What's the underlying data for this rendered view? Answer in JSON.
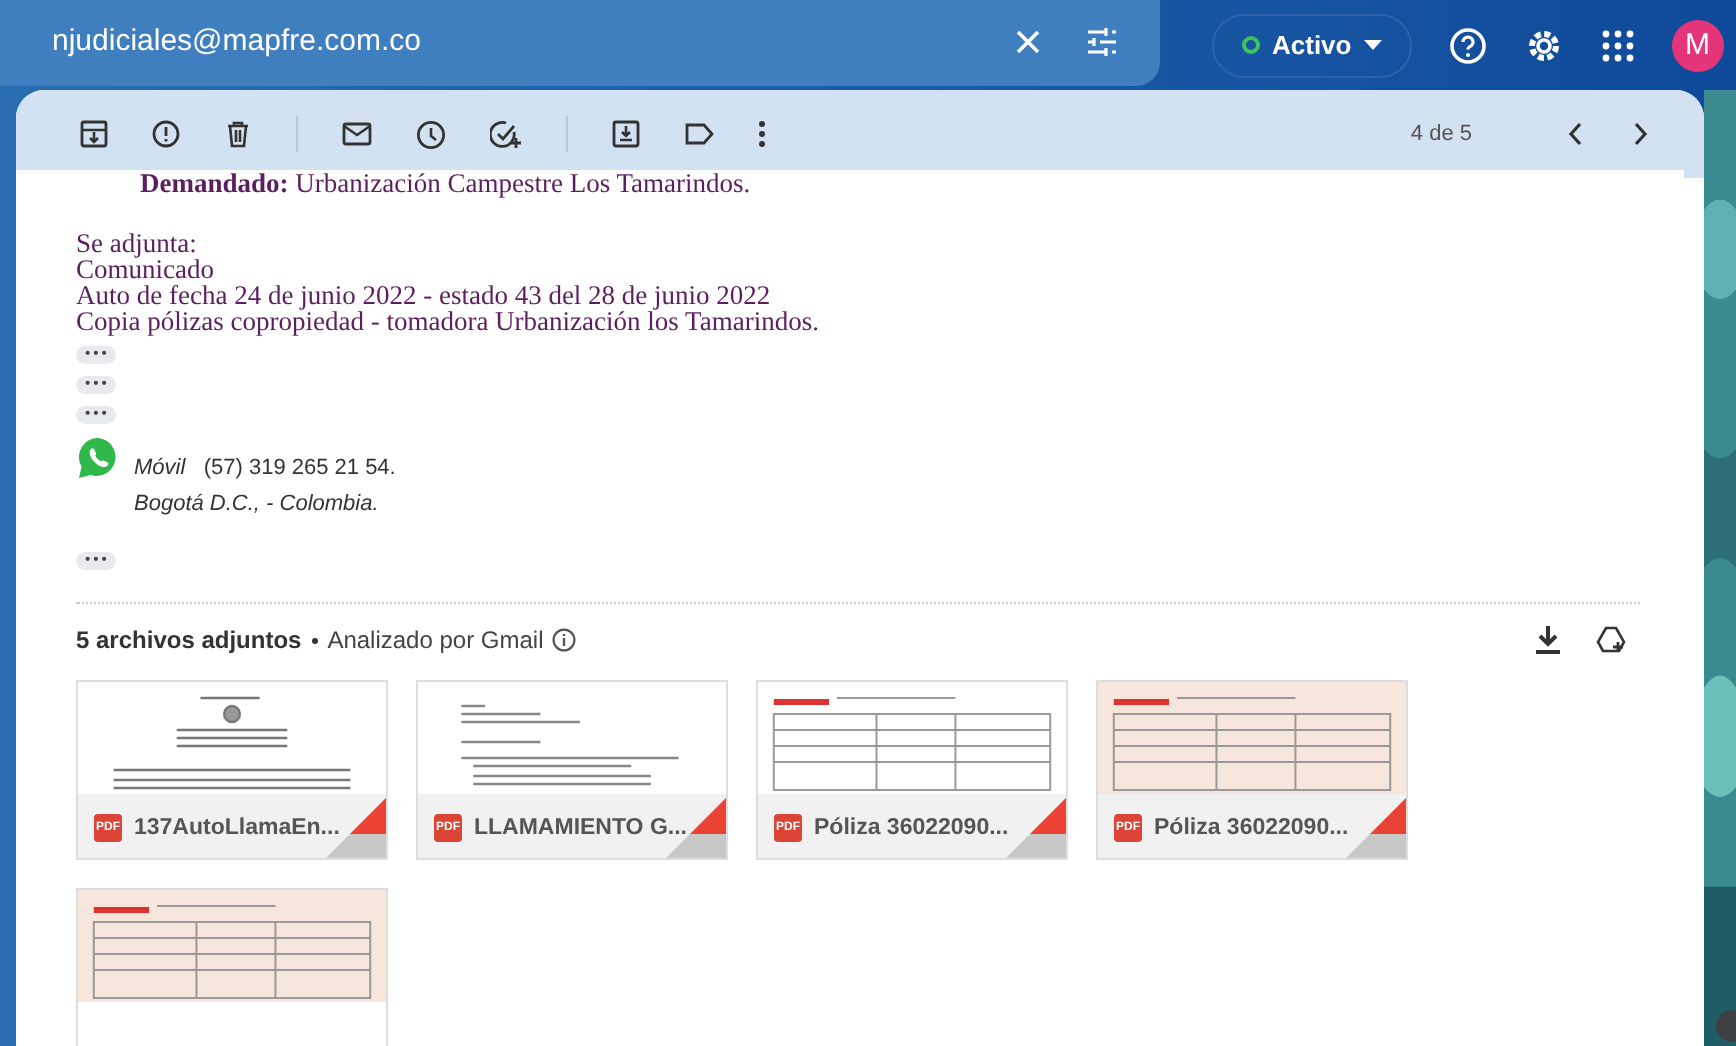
{
  "search": {
    "value": "njudiciales@mapfre.com.co"
  },
  "status": {
    "label": "Activo",
    "online": true
  },
  "avatar": {
    "letter": "M"
  },
  "toolbar": {
    "pager": "4 de 5"
  },
  "message": {
    "lines": [
      {
        "kind": "gap",
        "text": "**Demandado:** Urbanización Campestre Los Tamarindos."
      },
      {
        "kind": "gap",
        "text": "Se adjunta:"
      },
      {
        "kind": "line",
        "text": "Comunicado"
      },
      {
        "kind": "line",
        "text": "Auto de fecha 24 de junio 2022 - estado 43 del 28 de junio 2022"
      },
      {
        "kind": "line",
        "text": "Copia pólizas copropiedad - tomadora Urbanización los Tamarindos."
      }
    ],
    "trims": [
      "•••",
      "•••",
      "•••"
    ],
    "signature": {
      "label": "Móvil",
      "phone": "(57) 319 265 21 54.",
      "city": "Bogotá D.C., - Colombia."
    },
    "trim_end": "•••"
  },
  "attachments": {
    "count_label": "5 archivos adjuntos",
    "scan_label": "Analizado por Gmail",
    "items": [
      {
        "name": "137AutoLlamaEn...",
        "badge": "PDF",
        "color": "#ffffff"
      },
      {
        "name": "LLAMAMIENTO G...",
        "badge": "PDF",
        "color": "#ffffff"
      },
      {
        "name": "Póliza 36022090...",
        "badge": "PDF",
        "color": "#ffffff"
      },
      {
        "name": "Póliza 36022090...",
        "badge": "PDF",
        "color": "#f6e6dc"
      },
      {
        "color": "#f6e6dc"
      }
    ]
  }
}
